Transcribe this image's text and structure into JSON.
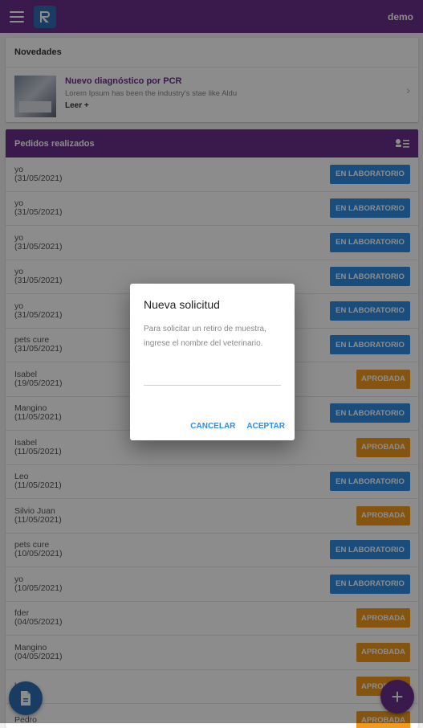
{
  "appbar": {
    "menu_icon": "menu-icon",
    "logo_icon": "r-logo-icon",
    "user_name": "demo"
  },
  "news": {
    "title": "Novedades",
    "item": {
      "headline": "Nuevo diagnóstico por PCR",
      "summary": "Lorem Ipsum has been the industry's stae like Aldu",
      "more": "Leer +"
    }
  },
  "orders": {
    "title": "Pedidos realizados",
    "rows": [
      {
        "name": "yo",
        "date": "(31/05/2021)",
        "status": "EN LABORATORIO",
        "kind": "lab"
      },
      {
        "name": "yo",
        "date": "(31/05/2021)",
        "status": "EN LABORATORIO",
        "kind": "lab"
      },
      {
        "name": "yo",
        "date": "(31/05/2021)",
        "status": "EN LABORATORIO",
        "kind": "lab"
      },
      {
        "name": "yo",
        "date": "(31/05/2021)",
        "status": "EN LABORATORIO",
        "kind": "lab"
      },
      {
        "name": "yo",
        "date": "(31/05/2021)",
        "status": "EN LABORATORIO",
        "kind": "lab"
      },
      {
        "name": "pets cure",
        "date": "(31/05/2021)",
        "status": "EN LABORATORIO",
        "kind": "lab"
      },
      {
        "name": "Isabel",
        "date": "(19/05/2021)",
        "status": "APROBADA",
        "kind": "ok"
      },
      {
        "name": "Mangino",
        "date": "(11/05/2021)",
        "status": "EN LABORATORIO",
        "kind": "lab"
      },
      {
        "name": "Isabel",
        "date": "(11/05/2021)",
        "status": "APROBADA",
        "kind": "ok"
      },
      {
        "name": "Leo",
        "date": "(11/05/2021)",
        "status": "EN LABORATORIO",
        "kind": "lab"
      },
      {
        "name": "Silvio Juan",
        "date": "(11/05/2021)",
        "status": "APROBADA",
        "kind": "ok"
      },
      {
        "name": "pets cure",
        "date": "(10/05/2021)",
        "status": "EN LABORATORIO",
        "kind": "lab"
      },
      {
        "name": "yo",
        "date": "(10/05/2021)",
        "status": "EN LABORATORIO",
        "kind": "lab"
      },
      {
        "name": "fder",
        "date": "(04/05/2021)",
        "status": "APROBADA",
        "kind": "ok"
      },
      {
        "name": "Mangino",
        "date": "(04/05/2021)",
        "status": "APROBADA",
        "kind": "ok"
      },
      {
        "name": "leo",
        "date": "",
        "status": "APROBADA",
        "kind": "ok"
      },
      {
        "name": "Pedro",
        "date": "",
        "status": "APROBADA",
        "kind": "ok"
      }
    ]
  },
  "fab": {
    "left_icon": "document-icon",
    "right_label": "+"
  },
  "dialog": {
    "title": "Nueva solicitud",
    "message": "Para solicitar un retiro de muestra, ingrese el nombre del veterinario.",
    "input_value": "",
    "cancel": "CANCELAR",
    "accept": "ACEPTAR"
  },
  "colors": {
    "primary": "#6b2f8a",
    "lab_badge": "#2f8de4",
    "approved_badge": "#f39a1a",
    "accent_blue": "#2e6fb2"
  }
}
